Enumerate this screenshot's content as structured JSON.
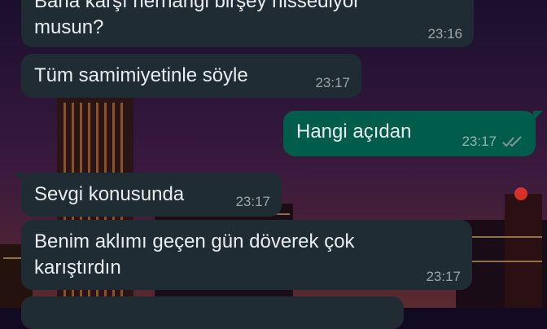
{
  "conversation": {
    "messages": [
      {
        "direction": "incoming",
        "text_partial_top": "Bana karşı herhangi birşey hissediyor",
        "text": "musun?",
        "time": "23:16"
      },
      {
        "direction": "incoming",
        "text": "Tüm samimiyetinle söyle",
        "time": "23:17"
      },
      {
        "direction": "outgoing",
        "text": "Hangi açıdan",
        "time": "23:17",
        "status_icon": "double-check-read-icon"
      },
      {
        "direction": "incoming",
        "text": "Sevgi konusunda",
        "time": "23:17"
      },
      {
        "direction": "incoming",
        "text": "Benim aklımı geçen gün döverek çok\nkarıştırdın",
        "time": "23:17"
      }
    ]
  },
  "colors": {
    "incoming_bubble": "#1f2c33",
    "outgoing_bubble": "#005c4b",
    "text": "#e9edef",
    "read_ticks": "#8696a0"
  },
  "wallpaper": "night city skyline"
}
